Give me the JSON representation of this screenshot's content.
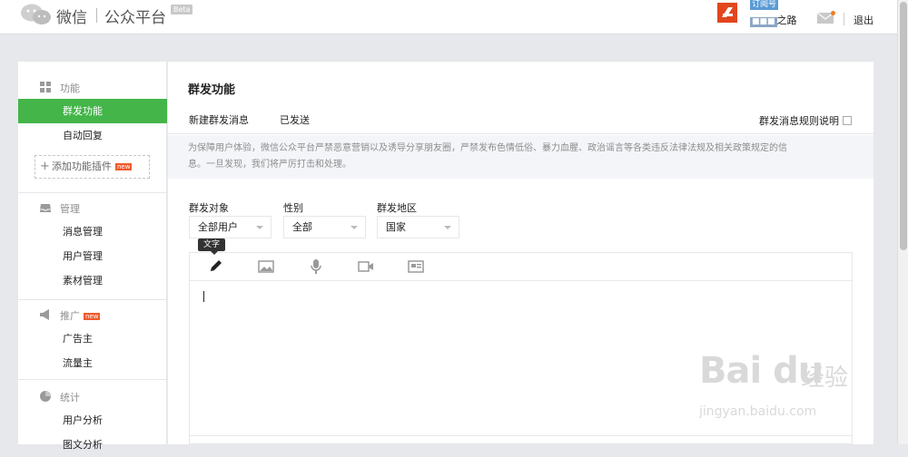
{
  "header": {
    "logo_text": "微信",
    "logo_sub": "公众平台",
    "beta": "Beta",
    "account_type": "订阅号",
    "account_mask": "■■■",
    "account_name_suffix": "之路",
    "logout": "退出"
  },
  "sidebar": {
    "sections": [
      {
        "title": "功能",
        "icon": "grid-icon",
        "items": [
          "群发功能",
          "自动回复"
        ],
        "add_plugin": "添加功能插件",
        "badge": "new"
      },
      {
        "title": "管理",
        "icon": "inbox-icon",
        "items": [
          "消息管理",
          "用户管理",
          "素材管理"
        ]
      },
      {
        "title": "推广",
        "icon": "megaphone-icon",
        "badge": "new",
        "items": [
          "广告主",
          "流量主"
        ]
      },
      {
        "title": "统计",
        "icon": "pie-chart-icon",
        "items": [
          "用户分析",
          "图文分析"
        ]
      }
    ]
  },
  "main": {
    "title": "群发功能",
    "tabs": [
      "新建群发消息",
      "已发送"
    ],
    "rule_link": "群发消息规则说明",
    "notice_line1": "为保障用户体验，微信公众平台严禁恶意营销以及诱导分享朋友圈，严禁发布色情低俗、暴力血腥、政治谣言等各类违反法律法规及相关政策规定的信",
    "notice_line2": "息。一旦发现，我们将严厉打击和处理。",
    "filters": [
      {
        "label": "群发对象",
        "value": "全部用户"
      },
      {
        "label": "性别",
        "value": "全部"
      },
      {
        "label": "群发地区",
        "value": "国家"
      }
    ],
    "tooltip": "文字",
    "tools": [
      "pencil-icon",
      "image-icon",
      "microphone-icon",
      "video-icon",
      "news-card-icon"
    ]
  },
  "watermark": {
    "brand": "Bai du",
    "cn": "经验",
    "url": "jingyan.baidu.com"
  }
}
